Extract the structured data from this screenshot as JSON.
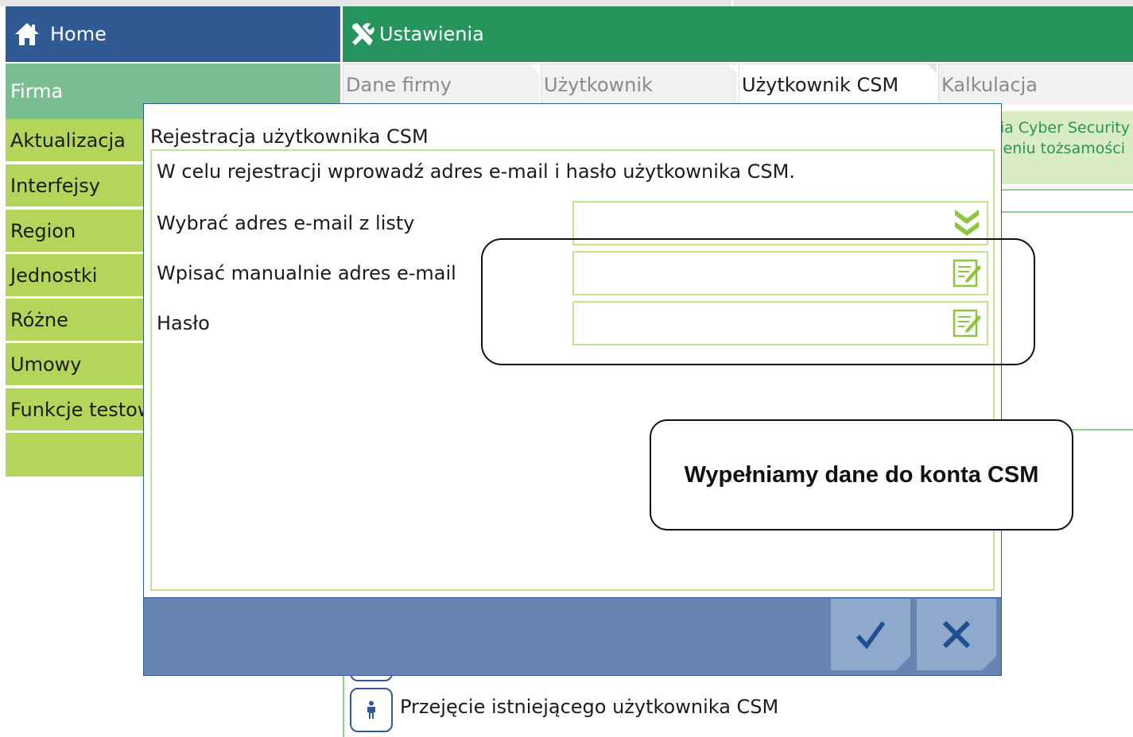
{
  "home": {
    "label": "Home",
    "icon": "home-icon"
  },
  "settings": {
    "label": "Ustawienia",
    "icon": "tools-icon"
  },
  "sidebar": {
    "section": "Firma",
    "items": [
      {
        "label": "Aktualizacja"
      },
      {
        "label": "Interfejsy"
      },
      {
        "label": "Region"
      },
      {
        "label": "Jednostki"
      },
      {
        "label": "Różne"
      },
      {
        "label": "Umowy"
      },
      {
        "label": "Funkcje testow"
      }
    ]
  },
  "tabs": [
    {
      "label": "Dane firmy",
      "active": false
    },
    {
      "label": "Użytkownik",
      "active": false
    },
    {
      "label": "Użytkownik CSM",
      "active": true
    },
    {
      "label": "Kalkulacja",
      "active": false
    }
  ],
  "background_info": {
    "line1": "ia Cyber Security",
    "line2": "eniu tożsamości"
  },
  "bottom": {
    "takeover_label": "Przejęcie istniejącego użytkownika CSM"
  },
  "modal": {
    "title": "Rejestracja użytkownika CSM",
    "instruction": "W celu rejestracji wprowadź adres e-mail i hasło użytkownika CSM.",
    "fields": [
      {
        "label": "Wybrać adres e-mail z listy",
        "value": "",
        "icon": "chevron-double-down-icon"
      },
      {
        "label": "Wpisać manualnie adres e-mail",
        "value": "",
        "icon": "edit-icon"
      },
      {
        "label": "Hasło",
        "value": "",
        "icon": "edit-icon"
      }
    ],
    "confirm_icon": "check-icon",
    "cancel_icon": "close-icon"
  },
  "annotation": {
    "text": "Wypełniamy dane do konta CSM"
  },
  "colors": {
    "home_blue": "#2f5a93",
    "settings_green": "#26945c",
    "firma_green": "#7bbd93",
    "sidebar_lime": "#b3d65a",
    "modal_bar": "#6785b0",
    "modal_button": "#8ea9cc"
  }
}
